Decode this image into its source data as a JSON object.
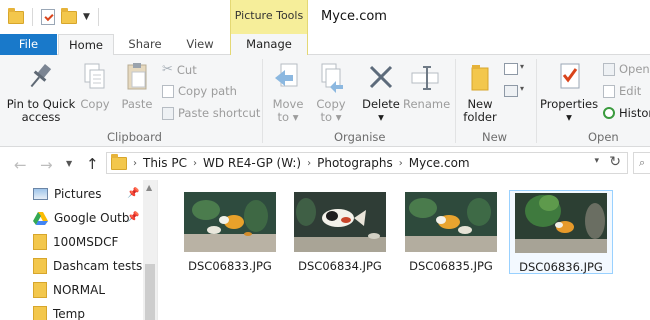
{
  "window": {
    "title": "Myce.com",
    "context_tab": "Picture Tools"
  },
  "tabs": {
    "file": "File",
    "home": "Home",
    "share": "Share",
    "view": "View",
    "manage": "Manage"
  },
  "ribbon": {
    "clipboard": {
      "label": "Clipboard",
      "pin_line1": "Pin to Quick",
      "pin_line2": "access",
      "copy": "Copy",
      "paste": "Paste",
      "cut": "Cut",
      "copy_path": "Copy path",
      "paste_shortcut": "Paste shortcut"
    },
    "organise": {
      "label": "Organise",
      "move_to": "Move",
      "move_to2": "to",
      "copy_to": "Copy",
      "copy_to2": "to",
      "delete": "Delete",
      "rename": "Rename"
    },
    "new": {
      "label": "New",
      "new_folder1": "New",
      "new_folder2": "folder"
    },
    "open": {
      "label": "Open",
      "properties": "Properties",
      "open": "Open",
      "edit": "Edit",
      "history": "Histor"
    }
  },
  "address": {
    "segments": [
      "This PC",
      "WD RE4-GP (W:)",
      "Photographs",
      "Myce.com"
    ]
  },
  "navpane": {
    "items": [
      {
        "label": "Pictures",
        "icon": "pictures-icon",
        "pinned": true
      },
      {
        "label": "Google Outb",
        "icon": "google-drive-icon",
        "pinned": true
      },
      {
        "label": "100MSDCF",
        "icon": "folder-icon",
        "pinned": false
      },
      {
        "label": "Dashcam tests",
        "icon": "folder-icon",
        "pinned": false
      },
      {
        "label": "NORMAL",
        "icon": "folder-icon",
        "pinned": false
      },
      {
        "label": "Temp",
        "icon": "folder-icon",
        "pinned": false
      }
    ]
  },
  "files": [
    {
      "name": "DSC06833.JPG",
      "selected": false
    },
    {
      "name": "DSC06834.JPG",
      "selected": false
    },
    {
      "name": "DSC06835.JPG",
      "selected": false
    },
    {
      "name": "DSC06836.JPG",
      "selected": true
    }
  ],
  "colors": {
    "file_tab": "#1979ca",
    "context_tab": "#f6ee9a",
    "selection_border": "#99d1ff",
    "folder": "#f3c74c"
  }
}
